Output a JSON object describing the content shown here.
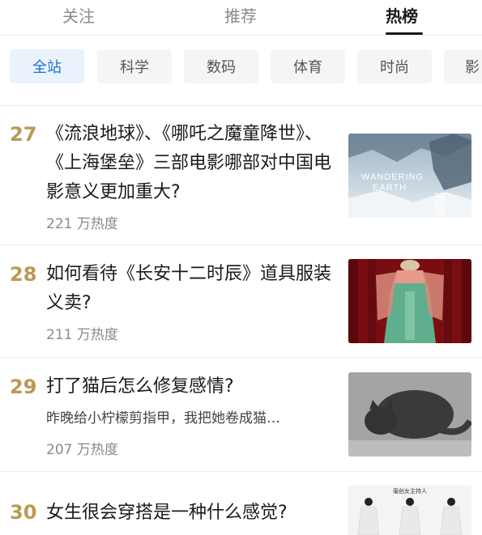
{
  "top_tabs": [
    "关注",
    "推荐",
    "热榜"
  ],
  "categories": [
    "全站",
    "科学",
    "数码",
    "体育",
    "时尚",
    "影"
  ],
  "items": [
    {
      "rank": "27",
      "title": "《流浪地球》、《哪吒之魔童降世》、《上海堡垒》三部电影哪部对中国电影意义更加重大?",
      "heat": "221 万热度",
      "thumb_text": [
        "WANDERING",
        "EARTH",
        "流浪地球"
      ]
    },
    {
      "rank": "28",
      "title": "如何看待《长安十二时辰》道具服装义卖?",
      "heat": "211 万热度"
    },
    {
      "rank": "29",
      "title": "打了猫后怎么修复感情?",
      "excerpt": "昨晚给小柠檬剪指甲，我把她卷成猫…",
      "heat": "207 万热度"
    },
    {
      "rank": "30",
      "title": "女生很会穿搭是一种什么感觉?",
      "thumb_text": [
        "毫创女主持人"
      ]
    }
  ],
  "colors": {
    "rank": "#b99a52",
    "active_chip_bg": "#eaf3fc",
    "active_chip_text": "#1a73c8"
  }
}
